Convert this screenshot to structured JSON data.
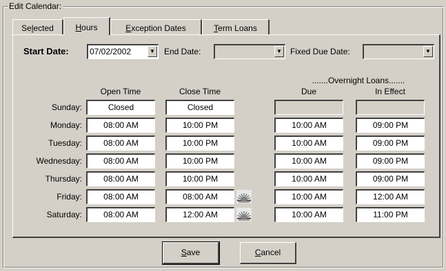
{
  "group": {
    "label": "Edit Calendar:"
  },
  "tabs": [
    {
      "label": "Selected",
      "mnemonic": "l",
      "active": false
    },
    {
      "label": "Hours",
      "mnemonic": "H",
      "active": true
    },
    {
      "label": "Exception Dates",
      "mnemonic": "E",
      "active": false
    },
    {
      "label": "Term Loans",
      "mnemonic": "T",
      "active": false
    }
  ],
  "filters": {
    "start_date_label": "Start Date:",
    "start_date_value": "07/02/2002",
    "end_date_label": "End Date:",
    "end_date_value": "",
    "fixed_due_date_label": "Fixed Due Date:",
    "fixed_due_date_value": ""
  },
  "headers": {
    "open_time": "Open Time",
    "close_time": "Close Time",
    "overnight": ".......Overnight Loans.......",
    "due": "Due",
    "in_effect": "In Effect"
  },
  "days": [
    {
      "label": "Sunday:",
      "open": "Closed",
      "close": "Closed",
      "due": "",
      "in_effect": "",
      "overnight_enabled": false,
      "sun_icon": false
    },
    {
      "label": "Monday:",
      "open": "08:00 AM",
      "close": "10:00 PM",
      "due": "10:00 AM",
      "in_effect": "09:00 PM",
      "overnight_enabled": true,
      "sun_icon": false
    },
    {
      "label": "Tuesday:",
      "open": "08:00 AM",
      "close": "10:00 PM",
      "due": "10:00 AM",
      "in_effect": "09:00 PM",
      "overnight_enabled": true,
      "sun_icon": false
    },
    {
      "label": "Wednesday:",
      "open": "08:00 AM",
      "close": "10:00 PM",
      "due": "10:00 AM",
      "in_effect": "09:00 PM",
      "overnight_enabled": true,
      "sun_icon": false
    },
    {
      "label": "Thursday:",
      "open": "08:00 AM",
      "close": "10:00 PM",
      "due": "10:00 AM",
      "in_effect": "09:00 PM",
      "overnight_enabled": true,
      "sun_icon": false
    },
    {
      "label": "Friday:",
      "open": "08:00 AM",
      "close": "08:00 AM",
      "due": "10:00 AM",
      "in_effect": "12:00 AM",
      "overnight_enabled": true,
      "sun_icon": true
    },
    {
      "label": "Saturday:",
      "open": "08:00 AM",
      "close": "12:00 AM",
      "due": "10:00 AM",
      "in_effect": "11:00 PM",
      "overnight_enabled": true,
      "sun_icon": true
    }
  ],
  "buttons": {
    "save_label": "Save",
    "cancel_label": "Cancel"
  }
}
